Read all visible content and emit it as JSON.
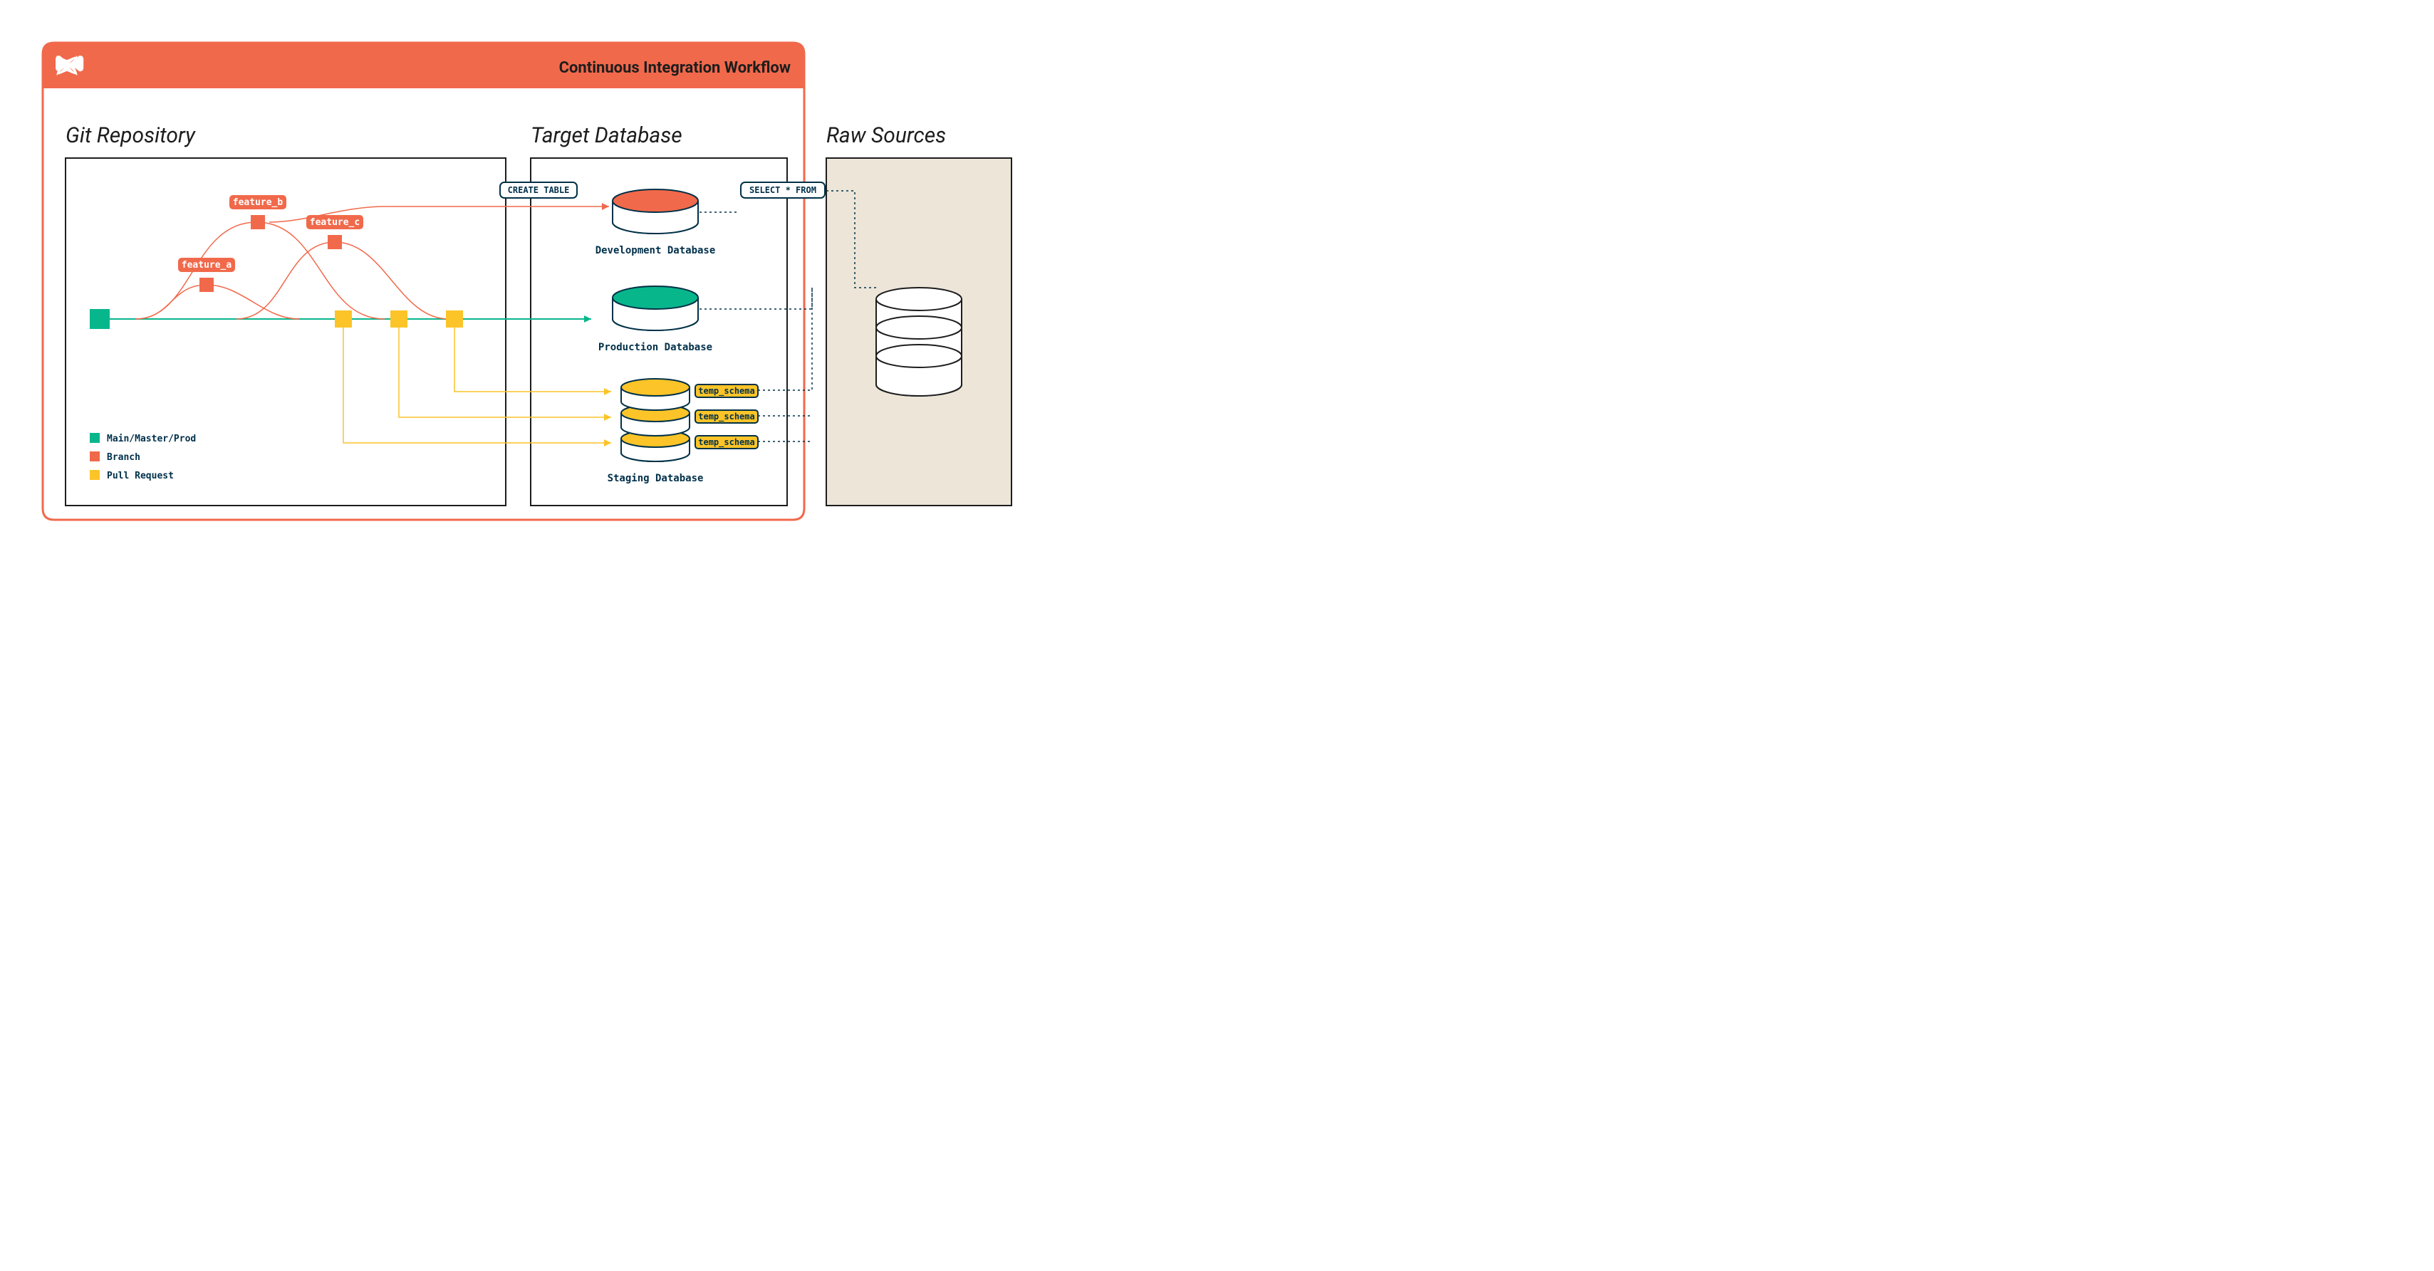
{
  "colors": {
    "orange": "#f1694b",
    "green": "#08b68c",
    "yellow": "#fcc428",
    "navy": "#003147",
    "beige": "#ece5d8",
    "white": "#ffffff"
  },
  "panel": {
    "title": "Continuous Integration Workflow"
  },
  "sections": {
    "git": "Git Repository",
    "target": "Target Database",
    "raw": "Raw Sources"
  },
  "branches": {
    "a": "feature_a",
    "b": "feature_b",
    "c": "feature_c"
  },
  "sql": {
    "create": "CREATE TABLE",
    "select": "SELECT * FROM"
  },
  "db": {
    "dev": "Development Database",
    "prod": "Production Database",
    "staging": "Staging Database"
  },
  "staging_schemas": [
    "temp_schema",
    "temp_schema",
    "temp_schema"
  ],
  "legend": {
    "main": "Main/Master/Prod",
    "branch": "Branch",
    "pr": "Pull Request"
  }
}
